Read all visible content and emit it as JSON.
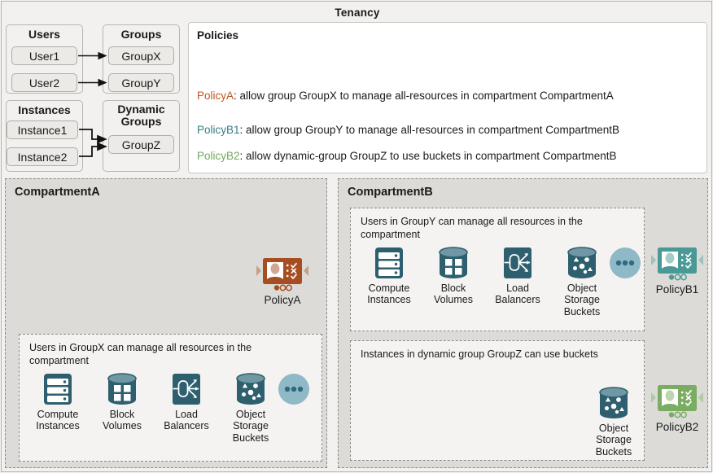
{
  "tenancy": {
    "title": "Tenancy"
  },
  "identity": {
    "users": {
      "title": "Users",
      "items": [
        "User1",
        "User2"
      ]
    },
    "groups": {
      "title": "Groups",
      "items": [
        "GroupX",
        "GroupY"
      ]
    },
    "instances": {
      "title": "Instances",
      "items": [
        "Instance1",
        "Instance2"
      ]
    },
    "dynamic_groups": {
      "title_line1": "Dynamic",
      "title_line2": "Groups",
      "items": [
        "GroupZ"
      ]
    }
  },
  "policies": {
    "title": "Policies",
    "items": [
      {
        "name": "PolicyA",
        "color": "#c0561f",
        "text": ": allow group GroupX to manage all-resources in compartment CompartmentA"
      },
      {
        "name": "PolicyB1",
        "color": "#2f7f85",
        "text": ": allow group GroupY to manage all-resources in compartment CompartmentB"
      },
      {
        "name": "PolicyB2",
        "color": "#72a95f",
        "text": ": allow dynamic-group GroupZ to use buckets in compartment CompartmentB"
      }
    ]
  },
  "compartmentA": {
    "title": "CompartmentA",
    "policy_badge": {
      "label": "PolicyA",
      "color": "#a64d22"
    },
    "inner": {
      "caption": "Users in GroupX can manage all resources in the compartment",
      "resources": [
        {
          "icon": "compute-instances-icon",
          "label_line1": "Compute",
          "label_line2": "Instances"
        },
        {
          "icon": "block-volumes-icon",
          "label_line1": "Block",
          "label_line2": "Volumes"
        },
        {
          "icon": "load-balancers-icon",
          "label_line1": "Load",
          "label_line2": "Balancers"
        },
        {
          "icon": "object-storage-icon",
          "label_line1": "Object",
          "label_line2": "Storage",
          "label_line3": "Buckets"
        }
      ],
      "more_icon": "more-dots-icon"
    }
  },
  "compartmentB": {
    "title": "CompartmentB",
    "inner1": {
      "caption": "Users in GroupY can manage all resources in the compartment",
      "resources": [
        {
          "icon": "compute-instances-icon",
          "label_line1": "Compute",
          "label_line2": "Instances"
        },
        {
          "icon": "block-volumes-icon",
          "label_line1": "Block",
          "label_line2": "Volumes"
        },
        {
          "icon": "load-balancers-icon",
          "label_line1": "Load",
          "label_line2": "Balancers"
        },
        {
          "icon": "object-storage-icon",
          "label_line1": "Object",
          "label_line2": "Storage",
          "label_line3": "Buckets"
        }
      ],
      "more_icon": "more-dots-icon",
      "policy_badge": {
        "label": "PolicyB1",
        "color": "#499a96"
      }
    },
    "inner2": {
      "caption": "Instances in dynamic group GroupZ can use buckets",
      "resources": [
        {
          "icon": "object-storage-icon",
          "label_line1": "Object",
          "label_line2": "Storage",
          "label_line3": "Buckets"
        }
      ],
      "policy_badge": {
        "label": "PolicyB2",
        "color": "#7aad62"
      }
    }
  },
  "colors": {
    "resource_icon": "#2e5f6e",
    "resource_icon_top": "#6f98a4",
    "dots_circle": "#8fb9c6",
    "dots": "#2e6b7d",
    "compartment_bg": "#dcdbd7",
    "panel_bg": "#f4f3f1",
    "page_bg": "#f2f1ef"
  }
}
